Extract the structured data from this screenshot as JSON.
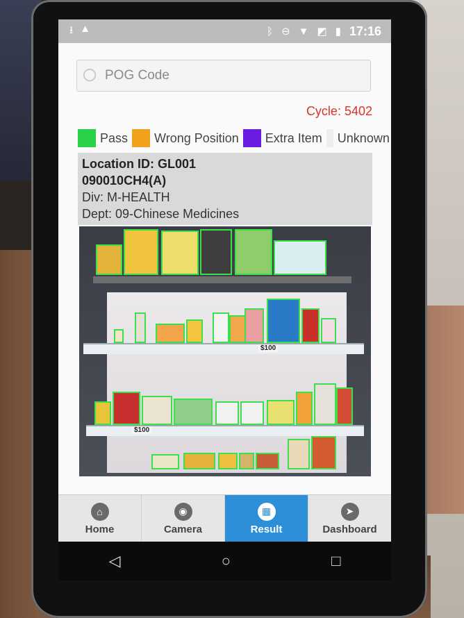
{
  "status_bar": {
    "time": "17:16",
    "left_icons": [
      "download-icon",
      "warning-icon"
    ],
    "right_icons": [
      "bluetooth-icon",
      "do-not-disturb-icon",
      "wifi-icon",
      "no-sim-icon",
      "battery-icon"
    ]
  },
  "search": {
    "placeholder": "POG Code"
  },
  "cycle": {
    "label": "Cycle: 5402",
    "color": "#d9342b"
  },
  "legend": [
    {
      "label": "Pass",
      "color": "#2ad24a"
    },
    {
      "label": "Wrong Position",
      "color": "#f0a21c"
    },
    {
      "label": "Extra Item",
      "color": "#6a1de0"
    },
    {
      "label": "Unknown",
      "color": "#eeeeee"
    }
  ],
  "location": {
    "location_id": "Location ID: GL001",
    "pog_code": "090010CH4(A)",
    "division": "Div: M-HEALTH",
    "department": "Dept: 09-Chinese Medicines"
  },
  "shelf_image": {
    "price_tags": [
      "$100",
      "$100"
    ],
    "detection_color": "#3de04a"
  },
  "bottom_nav": {
    "items": [
      {
        "label": "Home",
        "icon": "home-icon",
        "active": false
      },
      {
        "label": "Camera",
        "icon": "camera-icon",
        "active": false
      },
      {
        "label": "Result",
        "icon": "grid-icon",
        "active": true
      },
      {
        "label": "Dashboard",
        "icon": "navigation-arrow-icon",
        "active": false
      }
    ],
    "active_color": "#2e8fd9"
  },
  "system_nav": [
    "back-icon",
    "home-circle-icon",
    "recents-icon"
  ]
}
